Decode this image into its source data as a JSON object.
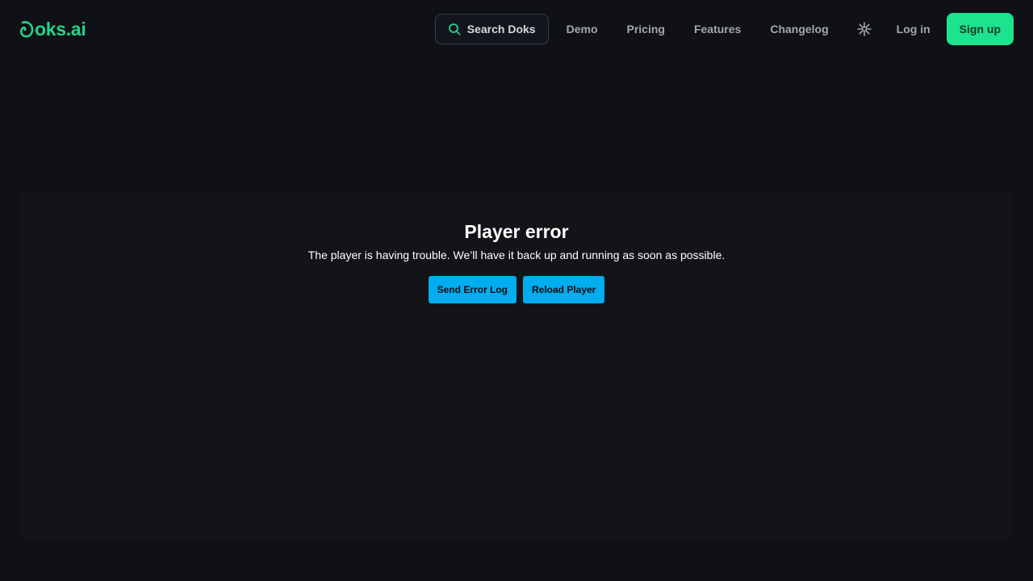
{
  "header": {
    "logo_text": "oks.ai",
    "search_label": "Search Doks",
    "nav": [
      "Demo",
      "Pricing",
      "Features",
      "Changelog"
    ],
    "login_label": "Log in",
    "signup_label": "Sign up",
    "theme_icon": "sun-icon"
  },
  "player": {
    "title": "Player error",
    "message": "The player is having trouble. We’ll have it back up and running as soon as possible.",
    "send_log_label": "Send Error Log",
    "reload_label": "Reload Player"
  },
  "colors": {
    "background": "#0f1116",
    "brand": "#22d38b",
    "signup_bg": "#1de38e",
    "player_button": "#00adef"
  }
}
